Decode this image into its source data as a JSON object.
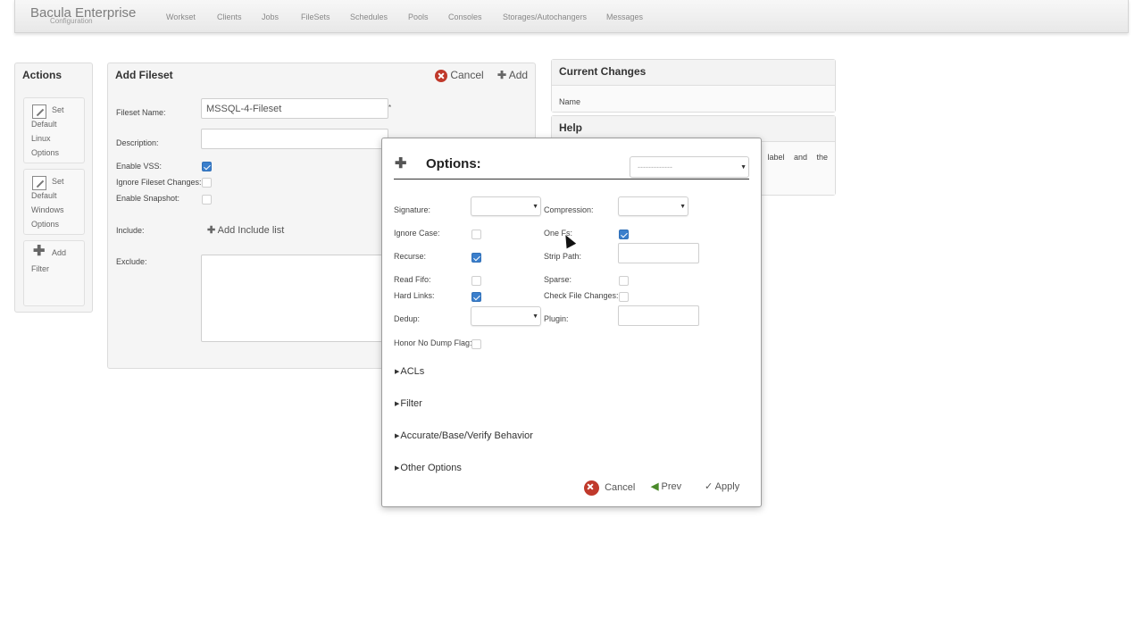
{
  "app": {
    "title": "Bacula Enterprise",
    "subtitle": "Configuration"
  },
  "nav": [
    "Workset",
    "Clients",
    "Jobs",
    "FileSets",
    "Schedules",
    "Pools",
    "Consoles",
    "Storages/Autochangers",
    "Messages"
  ],
  "actions": {
    "title": "Actions",
    "items": [
      {
        "label": "Set Default Linux Options"
      },
      {
        "label": "Set Default Windows Options"
      },
      {
        "label": "Add Filter"
      }
    ]
  },
  "fileset": {
    "title": "Add Fileset",
    "cancel_label": "Cancel",
    "add_label": "Add",
    "name_label": "Fileset Name:",
    "name_value": "MSSQL-4-Fileset",
    "required_mark": "*",
    "description_label": "Description:",
    "description_value": "",
    "enable_vss_label": "Enable VSS:",
    "enable_vss": true,
    "ignore_changes_label": "Ignore Fileset Changes:",
    "ignore_changes": false,
    "enable_snapshot_label": "Enable Snapshot:",
    "enable_snapshot": false,
    "include_label": "Include:",
    "add_include_label": "Add Include list",
    "exclude_label": "Exclude:"
  },
  "current_changes": {
    "title": "Current Changes",
    "column_name": "Name"
  },
  "help": {
    "title": "Help",
    "text_fragment": "e label and the"
  },
  "options_dialog": {
    "title": "Options:",
    "preset_value": "-------------",
    "signature_label": "Signature:",
    "compression_label": "Compression:",
    "ignore_case_label": "Ignore Case:",
    "ignore_case": false,
    "one_fs_label": "One Fs:",
    "one_fs": true,
    "recurse_label": "Recurse:",
    "recurse": true,
    "strip_path_label": "Strip Path:",
    "read_fifo_label": "Read Fifo:",
    "read_fifo": false,
    "sparse_label": "Sparse:",
    "sparse": false,
    "hard_links_label": "Hard Links:",
    "hard_links": true,
    "check_file_changes_label": "Check File Changes:",
    "check_file_changes": false,
    "dedup_label": "Dedup:",
    "plugin_label": "Plugin:",
    "honor_no_dump_label": "Honor No Dump Flag:",
    "honor_no_dump": false,
    "sections": [
      "ACLs",
      "Filter",
      "Accurate/Base/Verify Behavior",
      "Other Options"
    ],
    "cancel_label": "Cancel",
    "prev_label": "Prev",
    "apply_label": "Apply"
  }
}
